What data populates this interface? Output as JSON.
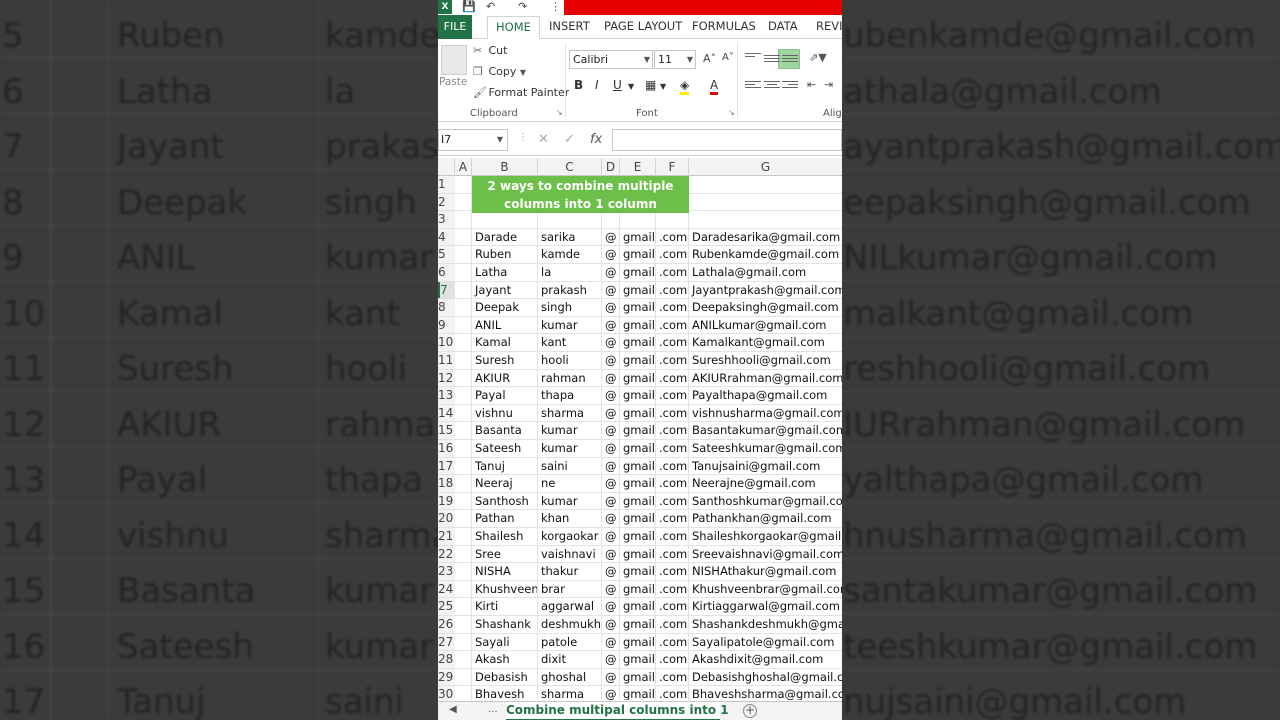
{
  "background": {
    "rows": [
      {
        "num": "5",
        "first": "Ruben",
        "last": "kamde",
        "email": "ubenkamde@gmail.com"
      },
      {
        "num": "6",
        "first": "Latha",
        "last": "la",
        "email": "athala@gmail.com"
      },
      {
        "num": "7",
        "first": "Jayant",
        "last": "prakas",
        "email": "ayantprakash@gmail.com"
      },
      {
        "num": "8",
        "first": "Deepak",
        "last": "singh",
        "email": "eepaksingh@gmail.com"
      },
      {
        "num": "9",
        "first": "ANIL",
        "last": "kumar",
        "email": "NILkumar@gmail.com"
      },
      {
        "num": "10",
        "first": "Kamal",
        "last": "kant",
        "email": "malkant@gmail.com"
      },
      {
        "num": "11",
        "first": "Suresh",
        "last": "hooli",
        "email": "reshhooli@gmail.com"
      },
      {
        "num": "12",
        "first": "AKIUR",
        "last": "rahma",
        "email": "IURrahman@gmail.com"
      },
      {
        "num": "13",
        "first": "Payal",
        "last": "thapa",
        "email": "yalthapa@gmail.com"
      },
      {
        "num": "14",
        "first": "vishnu",
        "last": "sharma",
        "email": "hnusharma@gmail.com"
      },
      {
        "num": "15",
        "first": "Basanta",
        "last": "kumar",
        "email": "santakumar@gmail.com"
      },
      {
        "num": "16",
        "first": "Sateesh",
        "last": "kumar",
        "email": "teeshkumar@gmail.com"
      },
      {
        "num": "17",
        "first": "Tanuj",
        "last": "saini",
        "email": "nujsaini@gmail.com"
      }
    ]
  },
  "ribbon": {
    "tabs": [
      "FILE",
      "HOME",
      "INSERT",
      "PAGE LAYOUT",
      "FORMULAS",
      "DATA",
      "REVIE"
    ],
    "clipboard": {
      "paste": "Paste",
      "cut": "Cut",
      "copy": "Copy",
      "format_painter": "Format Painter",
      "group_label": "Clipboard"
    },
    "font": {
      "name": "Calibri",
      "size": "11",
      "group_label": "Font",
      "bold": "B",
      "italic": "I",
      "underline": "U"
    },
    "alignment": {
      "group_label": "Alig"
    }
  },
  "formula_bar": {
    "name_box": "I7",
    "fx": "fx",
    "formula": ""
  },
  "columns": [
    "A",
    "B",
    "C",
    "D",
    "E",
    "F",
    "G"
  ],
  "title": {
    "line1": "2 ways to combine multiple",
    "line2": "columns into 1 column"
  },
  "colors": {
    "excel_green": "#217346",
    "title_fill": "#6cc04a",
    "red_bar": "#e60000"
  },
  "rows": [
    {
      "num": "4",
      "first": "Darade",
      "last": "sarika",
      "at": "@",
      "domain": "gmail",
      "tld": ".com",
      "email": "Daradesarika@gmail.com"
    },
    {
      "num": "5",
      "first": "Ruben",
      "last": "kamde",
      "at": "@",
      "domain": "gmail",
      "tld": ".com",
      "email": "Rubenkamde@gmail.com"
    },
    {
      "num": "6",
      "first": "Latha",
      "last": "la",
      "at": "@",
      "domain": "gmail",
      "tld": ".com",
      "email": "Lathala@gmail.com"
    },
    {
      "num": "7",
      "first": "Jayant",
      "last": "prakash",
      "at": "@",
      "domain": "gmail",
      "tld": ".com",
      "email": "Jayantprakash@gmail.com"
    },
    {
      "num": "8",
      "first": "Deepak",
      "last": "singh",
      "at": "@",
      "domain": "gmail",
      "tld": ".com",
      "email": "Deepaksingh@gmail.com"
    },
    {
      "num": "9",
      "first": "ANIL",
      "last": "kumar",
      "at": "@",
      "domain": "gmail",
      "tld": ".com",
      "email": "ANILkumar@gmail.com"
    },
    {
      "num": "10",
      "first": "Kamal",
      "last": "kant",
      "at": "@",
      "domain": "gmail",
      "tld": ".com",
      "email": "Kamalkant@gmail.com"
    },
    {
      "num": "11",
      "first": "Suresh",
      "last": "hooli",
      "at": "@",
      "domain": "gmail",
      "tld": ".com",
      "email": "Sureshhooli@gmail.com"
    },
    {
      "num": "12",
      "first": "AKIUR",
      "last": "rahman",
      "at": "@",
      "domain": "gmail",
      "tld": ".com",
      "email": "AKIURrahman@gmail.com"
    },
    {
      "num": "13",
      "first": "Payal",
      "last": "thapa",
      "at": "@",
      "domain": "gmail",
      "tld": ".com",
      "email": "Payalthapa@gmail.com"
    },
    {
      "num": "14",
      "first": "vishnu",
      "last": "sharma",
      "at": "@",
      "domain": "gmail",
      "tld": ".com",
      "email": "vishnusharma@gmail.com"
    },
    {
      "num": "15",
      "first": "Basanta",
      "last": "kumar",
      "at": "@",
      "domain": "gmail",
      "tld": ".com",
      "email": "Basantakumar@gmail.com"
    },
    {
      "num": "16",
      "first": "Sateesh",
      "last": "kumar",
      "at": "@",
      "domain": "gmail",
      "tld": ".com",
      "email": "Sateeshkumar@gmail.com"
    },
    {
      "num": "17",
      "first": "Tanuj",
      "last": "saini",
      "at": "@",
      "domain": "gmail",
      "tld": ".com",
      "email": "Tanujsaini@gmail.com"
    },
    {
      "num": "18",
      "first": "Neeraj",
      "last": "ne",
      "at": "@",
      "domain": "gmail",
      "tld": ".com",
      "email": "Neerajne@gmail.com"
    },
    {
      "num": "19",
      "first": "Santhosh",
      "last": "kumar",
      "at": "@",
      "domain": "gmail",
      "tld": ".com",
      "email": "Santhoshkumar@gmail.com"
    },
    {
      "num": "20",
      "first": "Pathan",
      "last": "khan",
      "at": "@",
      "domain": "gmail",
      "tld": ".com",
      "email": "Pathankhan@gmail.com"
    },
    {
      "num": "21",
      "first": "Shailesh",
      "last": "korgaokar",
      "at": "@",
      "domain": "gmail",
      "tld": ".com",
      "email": "Shaileshkorgaokar@gmail.com"
    },
    {
      "num": "22",
      "first": "Sree",
      "last": "vaishnavi",
      "at": "@",
      "domain": "gmail",
      "tld": ".com",
      "email": "Sreevaishnavi@gmail.com"
    },
    {
      "num": "23",
      "first": "NISHA",
      "last": "thakur",
      "at": "@",
      "domain": "gmail",
      "tld": ".com",
      "email": "NISHAthakur@gmail.com"
    },
    {
      "num": "24",
      "first": "Khushveen",
      "last": "brar",
      "at": "@",
      "domain": "gmail",
      "tld": ".com",
      "email": "Khushveenbrar@gmail.com"
    },
    {
      "num": "25",
      "first": "Kirti",
      "last": "aggarwal",
      "at": "@",
      "domain": "gmail",
      "tld": ".com",
      "email": "Kirtiaggarwal@gmail.com"
    },
    {
      "num": "26",
      "first": "Shashank",
      "last": "deshmukh",
      "at": "@",
      "domain": "gmail",
      "tld": ".com",
      "email": "Shashankdeshmukh@gmail.com"
    },
    {
      "num": "27",
      "first": "Sayali",
      "last": "patole",
      "at": "@",
      "domain": "gmail",
      "tld": ".com",
      "email": "Sayalipatole@gmail.com"
    },
    {
      "num": "28",
      "first": "Akash",
      "last": "dixit",
      "at": "@",
      "domain": "gmail",
      "tld": ".com",
      "email": "Akashdixit@gmail.com"
    },
    {
      "num": "29",
      "first": "Debasish",
      "last": "ghoshal",
      "at": "@",
      "domain": "gmail",
      "tld": ".com",
      "email": "Debasishghoshal@gmail.com"
    },
    {
      "num": "30",
      "first": "Bhavesh",
      "last": "sharma",
      "at": "@",
      "domain": "gmail",
      "tld": ".com",
      "email": "Bhaveshsharma@gmail.com"
    }
  ],
  "selected_row": "7",
  "sheet": {
    "nav_prev": "◀",
    "nav_more": "...",
    "tab_label": "Combine multipal columns into 1",
    "add": "+"
  }
}
